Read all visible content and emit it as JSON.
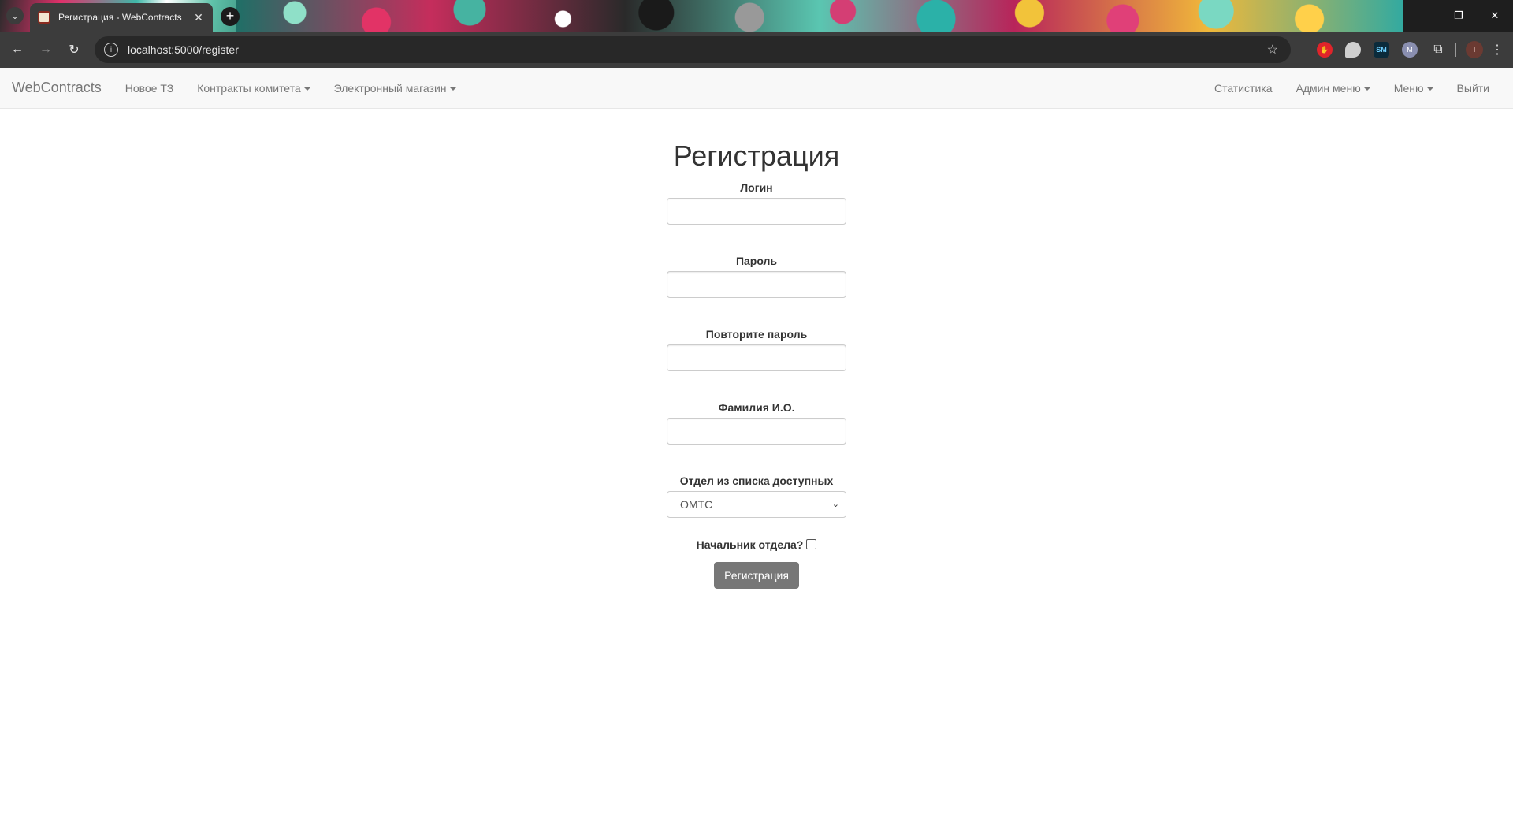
{
  "browser": {
    "tab_title": "Регистрация - WebContracts",
    "url": "localhost:5000/register",
    "profile_initial": "T",
    "extensions": [
      "adblock-icon",
      "extension-icon",
      "sm-icon",
      "m-icon",
      "puzzle-icon"
    ],
    "ext_sm_label": "SM",
    "ext_m_label": "M"
  },
  "navbar": {
    "brand": "WebContracts",
    "left_items": [
      {
        "label": "Новое ТЗ"
      },
      {
        "label": "Контракты комитета"
      },
      {
        "label": "Электронный магазин"
      }
    ],
    "right_items": [
      {
        "label": "Статистика"
      },
      {
        "label": "Админ меню"
      },
      {
        "label": "Меню"
      },
      {
        "label": "Выйти"
      }
    ]
  },
  "form": {
    "title": "Регистрация",
    "login_label": "Логин",
    "login_value": "",
    "password_label": "Пароль",
    "password_value": "",
    "repeat_password_label": "Повторите пароль",
    "repeat_password_value": "",
    "fullname_label": "Фамилия И.О.",
    "fullname_value": "",
    "department_label": "Отдел из списка доступных",
    "department_selected": "ОМТС",
    "head_label": "Начальник отдела?",
    "head_checked": false,
    "submit_label": "Регистрация"
  }
}
